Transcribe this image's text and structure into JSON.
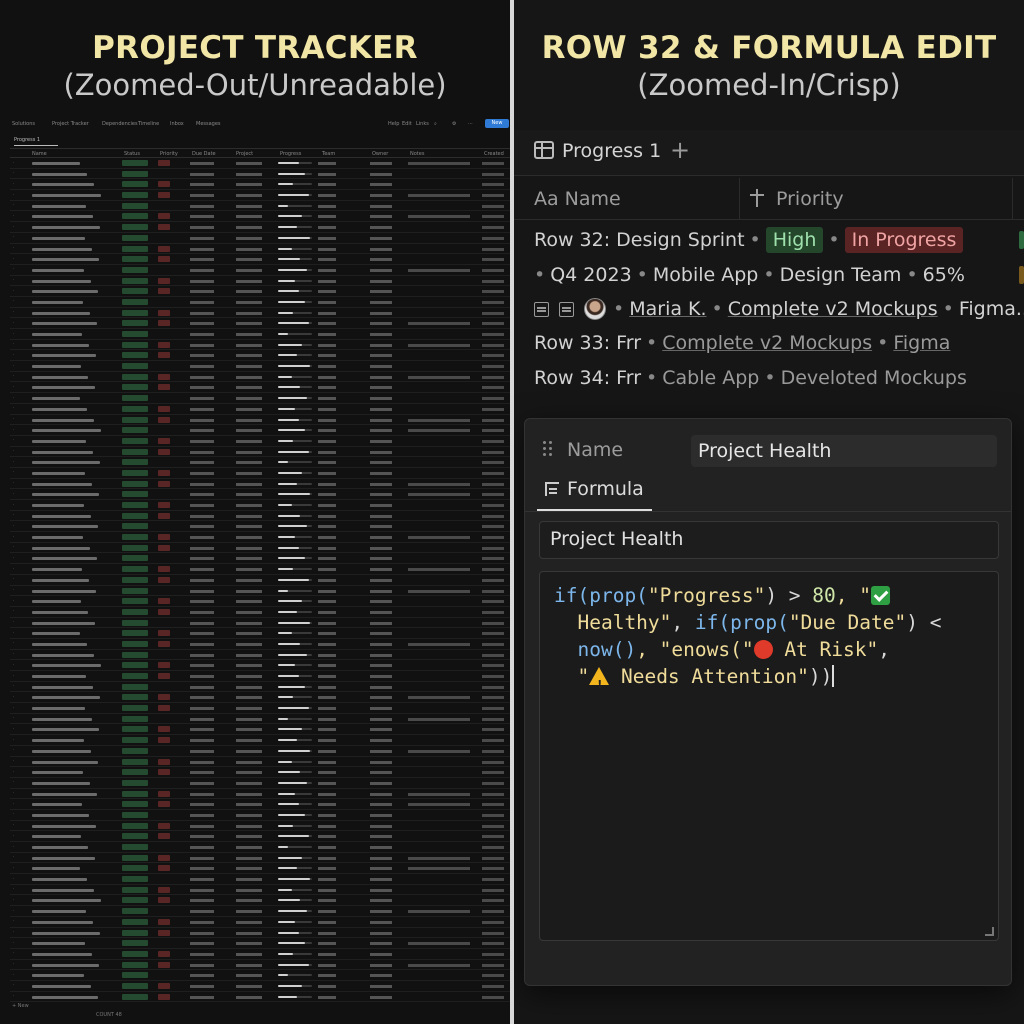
{
  "left": {
    "title": "PROJECT TRACKER",
    "subtitle": "(Zoomed-Out/Unreadable)",
    "tiny_top": [
      "Solutions",
      "Project Tracker",
      "Dependencies",
      "Timeline",
      "Inbox",
      "Messages"
    ],
    "tiny_top_right": [
      "Help",
      "Edit",
      "Links"
    ],
    "new_button": "New",
    "tab": "Progress 1",
    "headers": [
      "Name",
      "Status",
      "Priority",
      "Due Date",
      "Project",
      "Progress",
      "Team",
      "Owner",
      "Notes",
      "Created"
    ],
    "footer": "New",
    "count": "COUNT 48"
  },
  "right": {
    "title": "ROW 32 & FORMULA EDIT",
    "subtitle": "(Zoomed-In/Crisp)",
    "tab_label": "Progress 1",
    "tab_plus": "+",
    "col_name": "Aa Name",
    "col_priority": "Priority",
    "row32": {
      "label": "Row 32: Design Sprint",
      "priority": "High",
      "status": "In Progress",
      "quarter": "Q4 2023",
      "project": "Mobile App",
      "team": "Design Team",
      "progress": "65%",
      "owner": "Maria K.",
      "notes": "Complete v2 Mockups",
      "tool": "Figma..."
    },
    "row33": {
      "label": "Row 33: Frr",
      "notes": "Complete v2 Mockups",
      "tool": "Figma"
    },
    "row34": {
      "label": "Row 34: Frr",
      "project": "Cable App",
      "notes": "Develoted Mockups"
    },
    "editor": {
      "name_label": "Name",
      "name_value": "Project Health",
      "formula_tab": "Formula",
      "formula_name": "Project Health",
      "code": {
        "l1_fn": "if(prop(",
        "l1_str": "\"Progress\"",
        "l1_op": ") > ",
        "l1_num": "80",
        "l1_sep": ", \"",
        "l2_str": "Healthy\"",
        "l2_op": ", ",
        "l2_fn": "if(prop(",
        "l2_str2": "\"Due Date\"",
        "l2_op2": ") <",
        "l3_fn": "now()",
        "l3_op": ", \"enows(\"",
        "l3_str": " At Risk\"",
        "l3_op2": ",",
        "l4_str": "\"",
        "l4_str2": " Needs Attention\"",
        "l4_op": "))"
      }
    }
  },
  "colors": {
    "title_yellow": "#f1e6a6",
    "high_bg": "#24472c",
    "in_progress_bg": "#5a2324",
    "code_fn": "#7cb6ea",
    "code_str": "#f0dc9a"
  }
}
